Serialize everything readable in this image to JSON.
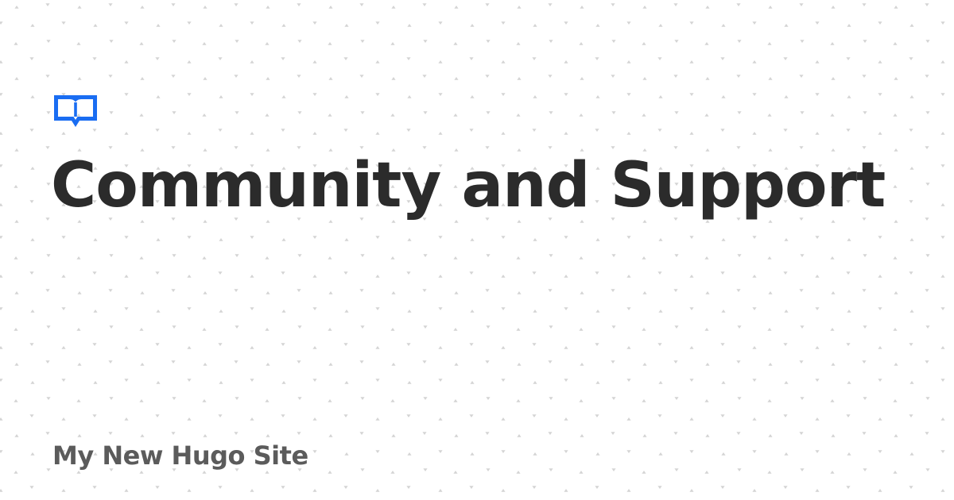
{
  "page": {
    "title": "Community and Support",
    "site_name": "My New Hugo Site"
  },
  "logo": {
    "icon": "open-book-icon",
    "color": "#1a6df2"
  },
  "colors": {
    "background": "#ffffff",
    "title_text": "#2b2b2b",
    "site_name_text": "#5b5b5b",
    "pattern_mark": "#d4d4d4"
  }
}
